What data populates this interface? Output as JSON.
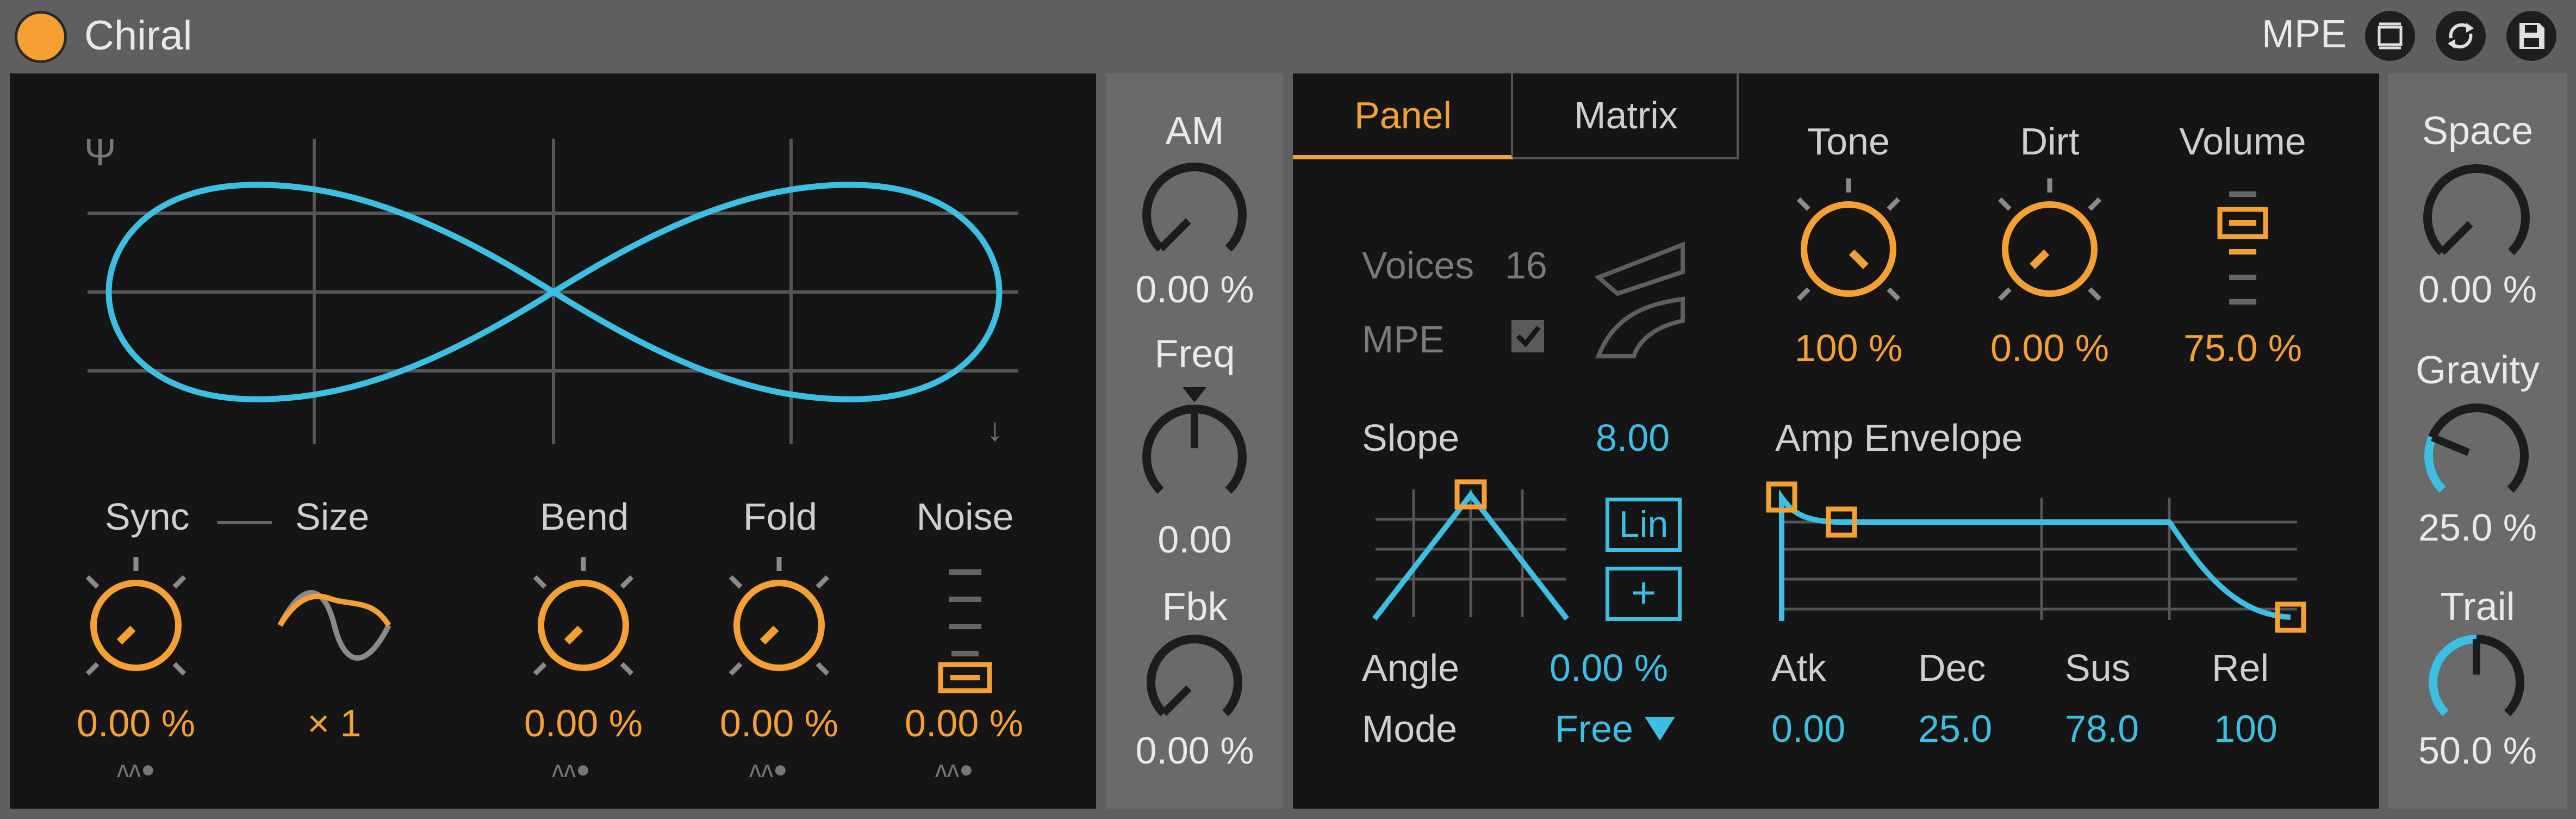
{
  "header": {
    "title": "Chiral",
    "mpe_label": "MPE",
    "icons": [
      "device-icon",
      "refresh-icon",
      "save-icon"
    ]
  },
  "colors": {
    "accent": "#f5a033",
    "cyan": "#3cbfe2",
    "bg": "#5f5f5f",
    "panel": "#151515"
  },
  "left": {
    "sync": {
      "label": "Sync",
      "value": "0.00 %"
    },
    "size": {
      "label": "Size",
      "value": "× 1"
    },
    "bend": {
      "label": "Bend",
      "value": "0.00 %"
    },
    "fold": {
      "label": "Fold",
      "value": "0.00 %"
    },
    "noise": {
      "label": "Noise",
      "value": "0.00 %",
      "level": 0
    }
  },
  "mod": {
    "am": {
      "label": "AM",
      "value": "0.00 %",
      "level": 0
    },
    "freq": {
      "label": "Freq",
      "value": "0.00",
      "level": 0.5
    },
    "fbk": {
      "label": "Fbk",
      "value": "0.00 %",
      "level": 0
    }
  },
  "tabs": {
    "panel": "Panel",
    "matrix": "Matrix"
  },
  "voices": {
    "voices_label": "Voices",
    "voices_value": "16",
    "mpe_label": "MPE",
    "mpe_checked": true
  },
  "tone": {
    "label": "Tone",
    "value": "100 %",
    "level": 1
  },
  "dirt": {
    "label": "Dirt",
    "value": "0.00 %",
    "level": 0
  },
  "volume": {
    "label": "Volume",
    "value": "75.0 %",
    "level": 0.75
  },
  "slope": {
    "label": "Slope",
    "value": "8.00",
    "lin": "Lin",
    "plus": "+"
  },
  "angle": {
    "label": "Angle",
    "value": "0.00 %"
  },
  "mode": {
    "label": "Mode",
    "value": "Free"
  },
  "env": {
    "title": "Amp Envelope",
    "atk": {
      "label": "Atk",
      "value": "0.00"
    },
    "dec": {
      "label": "Dec",
      "value": "25.0"
    },
    "sus": {
      "label": "Sus",
      "value": "78.0"
    },
    "rel": {
      "label": "Rel",
      "value": "100"
    }
  },
  "fx": {
    "space": {
      "label": "Space",
      "value": "0.00 %",
      "level": 0
    },
    "gravity": {
      "label": "Gravity",
      "value": "25.0 %",
      "level": 0.25
    },
    "trail": {
      "label": "Trail",
      "value": "50.0 %",
      "level": 0.5
    }
  }
}
